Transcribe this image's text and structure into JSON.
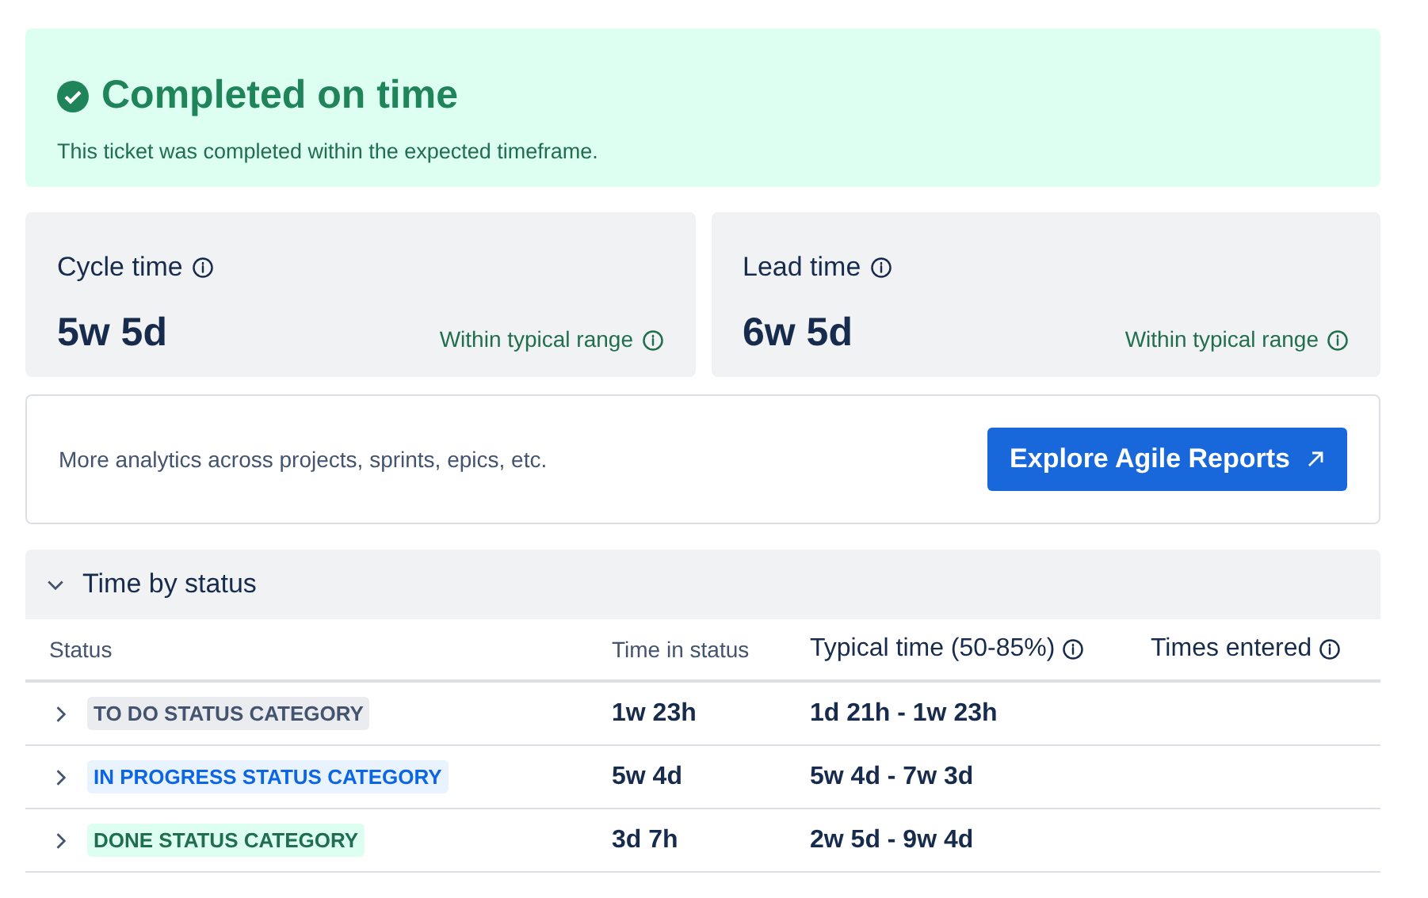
{
  "banner": {
    "title": "Completed on time",
    "message": "This ticket was completed within the expected timeframe."
  },
  "metrics": [
    {
      "label": "Cycle time",
      "value": "5w 5d",
      "range": "Within typical range"
    },
    {
      "label": "Lead time",
      "value": "6w 5d",
      "range": "Within typical range"
    }
  ],
  "analytics": {
    "text": "More analytics across projects, sprints, epics, etc.",
    "button": "Explore Agile Reports"
  },
  "time_by_status": {
    "title": "Time by status",
    "expanded": true,
    "columns": [
      {
        "label": "Status",
        "info": false
      },
      {
        "label": "Time in status",
        "info": false
      },
      {
        "label": "Typical time (50-85%)",
        "info": true
      },
      {
        "label": "Times entered",
        "info": true
      }
    ],
    "rows": [
      {
        "status": "TO DO STATUS CATEGORY",
        "kind": "todo",
        "expanded": false,
        "time": "1w 23h",
        "typical": "1d 21h - 1w 23h"
      },
      {
        "status": "IN PROGRESS STATUS CATEGORY",
        "kind": "inprogress",
        "expanded": false,
        "time": "5w 4d",
        "typical": "5w 4d - 7w 3d"
      },
      {
        "status": "DONE STATUS CATEGORY",
        "kind": "done",
        "expanded": false,
        "time": "3d 7h",
        "typical": "2w 5d - 9w 4d"
      }
    ]
  }
}
